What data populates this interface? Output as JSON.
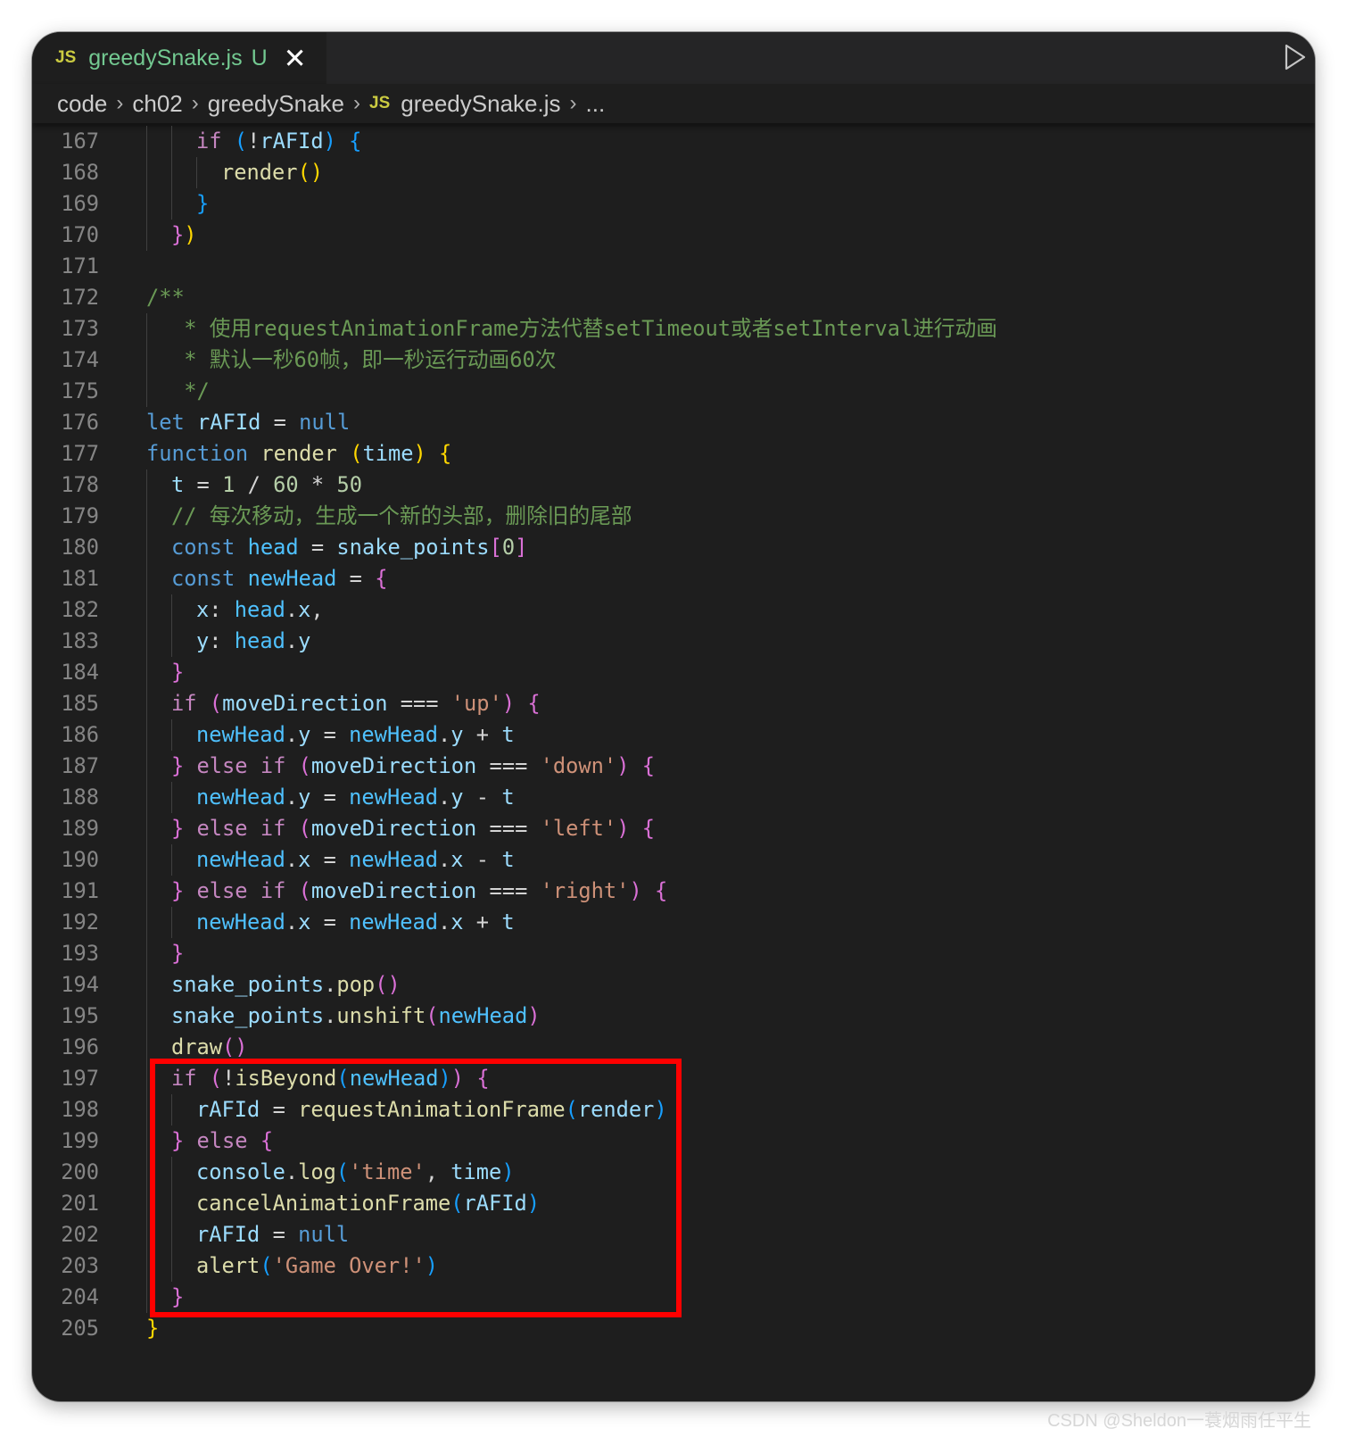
{
  "tab": {
    "file_icon": "JS",
    "title": "greedySnake.js",
    "status": "U",
    "close": "✕"
  },
  "breadcrumb": {
    "items": [
      "code",
      "ch02",
      "greedySnake"
    ],
    "file_icon": "JS",
    "file": "greedySnake.js",
    "more": "..."
  },
  "run_icon": "run-play-icon",
  "watermark": "CSDN @Sheldon一蓑烟雨任平生",
  "highlight_color": "#ff0000",
  "lines": [
    {
      "n": "167",
      "g": [
        1,
        2
      ],
      "t": [
        [
          "ctl",
          "if "
        ],
        [
          "b3",
          "("
        ],
        [
          "op",
          "!"
        ],
        [
          "var",
          "rAFId"
        ],
        [
          "b3",
          ")"
        ],
        [
          "op",
          " "
        ],
        [
          "b3",
          "{"
        ]
      ]
    },
    {
      "n": "168",
      "g": [
        1,
        2,
        3
      ],
      "t": [
        [
          "fn",
          "render"
        ],
        [
          "b1",
          "()"
        ]
      ]
    },
    {
      "n": "169",
      "g": [
        1,
        2
      ],
      "t": [
        [
          "b3",
          "}"
        ]
      ]
    },
    {
      "n": "170",
      "g": [
        1
      ],
      "t": [
        [
          "b2",
          "}"
        ],
        [
          "b1",
          ")"
        ]
      ]
    },
    {
      "n": "171",
      "g": [],
      "t": []
    },
    {
      "n": "172",
      "g": [],
      "t": [
        [
          "cmt",
          "/**"
        ]
      ]
    },
    {
      "n": "173",
      "g": [
        1
      ],
      "t": [
        [
          "cmt",
          " * 使用requestAnimationFrame方法代替setTimeout或者setInterval进行动画"
        ]
      ]
    },
    {
      "n": "174",
      "g": [
        1
      ],
      "t": [
        [
          "cmt",
          " * 默认一秒60帧，即一秒运行动画60次"
        ]
      ]
    },
    {
      "n": "175",
      "g": [
        1
      ],
      "t": [
        [
          "cmt",
          " */"
        ]
      ]
    },
    {
      "n": "176",
      "g": [],
      "t": [
        [
          "kw",
          "let "
        ],
        [
          "var",
          "rAFId"
        ],
        [
          "op",
          " = "
        ],
        [
          "kw",
          "null"
        ]
      ]
    },
    {
      "n": "177",
      "g": [],
      "t": [
        [
          "kw",
          "function "
        ],
        [
          "fn",
          "render"
        ],
        [
          "op",
          " "
        ],
        [
          "b1",
          "("
        ],
        [
          "var",
          "time"
        ],
        [
          "b1",
          ")"
        ],
        [
          "op",
          " "
        ],
        [
          "b1",
          "{"
        ]
      ]
    },
    {
      "n": "178",
      "g": [
        1
      ],
      "t": [
        [
          "var",
          "t"
        ],
        [
          "op",
          " = "
        ],
        [
          "num",
          "1"
        ],
        [
          "op",
          " / "
        ],
        [
          "num",
          "60"
        ],
        [
          "op",
          " * "
        ],
        [
          "num",
          "50"
        ]
      ]
    },
    {
      "n": "179",
      "g": [
        1
      ],
      "t": [
        [
          "cmt",
          "// 每次移动，生成一个新的头部，删除旧的尾部"
        ]
      ]
    },
    {
      "n": "180",
      "g": [
        1
      ],
      "t": [
        [
          "kw",
          "const "
        ],
        [
          "cst",
          "head"
        ],
        [
          "op",
          " = "
        ],
        [
          "var",
          "snake_points"
        ],
        [
          "b2",
          "["
        ],
        [
          "num",
          "0"
        ],
        [
          "b2",
          "]"
        ]
      ]
    },
    {
      "n": "181",
      "g": [
        1
      ],
      "t": [
        [
          "kw",
          "const "
        ],
        [
          "cst",
          "newHead"
        ],
        [
          "op",
          " = "
        ],
        [
          "b2",
          "{"
        ]
      ]
    },
    {
      "n": "182",
      "g": [
        1,
        2
      ],
      "t": [
        [
          "var",
          "x"
        ],
        [
          "op",
          ": "
        ],
        [
          "cst",
          "head"
        ],
        [
          "op",
          "."
        ],
        [
          "var",
          "x"
        ],
        [
          "op",
          ","
        ]
      ]
    },
    {
      "n": "183",
      "g": [
        1,
        2
      ],
      "t": [
        [
          "var",
          "y"
        ],
        [
          "op",
          ": "
        ],
        [
          "cst",
          "head"
        ],
        [
          "op",
          "."
        ],
        [
          "var",
          "y"
        ]
      ]
    },
    {
      "n": "184",
      "g": [
        1
      ],
      "t": [
        [
          "b2",
          "}"
        ]
      ]
    },
    {
      "n": "185",
      "g": [
        1
      ],
      "t": [
        [
          "ctl",
          "if "
        ],
        [
          "b2",
          "("
        ],
        [
          "var",
          "moveDirection"
        ],
        [
          "op",
          " === "
        ],
        [
          "str",
          "'up'"
        ],
        [
          "b2",
          ")"
        ],
        [
          "op",
          " "
        ],
        [
          "b2",
          "{"
        ]
      ]
    },
    {
      "n": "186",
      "g": [
        1,
        2
      ],
      "t": [
        [
          "cst",
          "newHead"
        ],
        [
          "op",
          "."
        ],
        [
          "var",
          "y"
        ],
        [
          "op",
          " = "
        ],
        [
          "cst",
          "newHead"
        ],
        [
          "op",
          "."
        ],
        [
          "var",
          "y"
        ],
        [
          "op",
          " + "
        ],
        [
          "var",
          "t"
        ]
      ]
    },
    {
      "n": "187",
      "g": [
        1
      ],
      "t": [
        [
          "b2",
          "}"
        ],
        [
          "ctl",
          " else if "
        ],
        [
          "b2",
          "("
        ],
        [
          "var",
          "moveDirection"
        ],
        [
          "op",
          " === "
        ],
        [
          "str",
          "'down'"
        ],
        [
          "b2",
          ")"
        ],
        [
          "op",
          " "
        ],
        [
          "b2",
          "{"
        ]
      ]
    },
    {
      "n": "188",
      "g": [
        1,
        2
      ],
      "t": [
        [
          "cst",
          "newHead"
        ],
        [
          "op",
          "."
        ],
        [
          "var",
          "y"
        ],
        [
          "op",
          " = "
        ],
        [
          "cst",
          "newHead"
        ],
        [
          "op",
          "."
        ],
        [
          "var",
          "y"
        ],
        [
          "op",
          " - "
        ],
        [
          "var",
          "t"
        ]
      ]
    },
    {
      "n": "189",
      "g": [
        1
      ],
      "t": [
        [
          "b2",
          "}"
        ],
        [
          "ctl",
          " else if "
        ],
        [
          "b2",
          "("
        ],
        [
          "var",
          "moveDirection"
        ],
        [
          "op",
          " === "
        ],
        [
          "str",
          "'left'"
        ],
        [
          "b2",
          ")"
        ],
        [
          "op",
          " "
        ],
        [
          "b2",
          "{"
        ]
      ]
    },
    {
      "n": "190",
      "g": [
        1,
        2
      ],
      "t": [
        [
          "cst",
          "newHead"
        ],
        [
          "op",
          "."
        ],
        [
          "var",
          "x"
        ],
        [
          "op",
          " = "
        ],
        [
          "cst",
          "newHead"
        ],
        [
          "op",
          "."
        ],
        [
          "var",
          "x"
        ],
        [
          "op",
          " - "
        ],
        [
          "var",
          "t"
        ]
      ]
    },
    {
      "n": "191",
      "g": [
        1
      ],
      "t": [
        [
          "b2",
          "}"
        ],
        [
          "ctl",
          " else if "
        ],
        [
          "b2",
          "("
        ],
        [
          "var",
          "moveDirection"
        ],
        [
          "op",
          " === "
        ],
        [
          "str",
          "'right'"
        ],
        [
          "b2",
          ")"
        ],
        [
          "op",
          " "
        ],
        [
          "b2",
          "{"
        ]
      ]
    },
    {
      "n": "192",
      "g": [
        1,
        2
      ],
      "t": [
        [
          "cst",
          "newHead"
        ],
        [
          "op",
          "."
        ],
        [
          "var",
          "x"
        ],
        [
          "op",
          " = "
        ],
        [
          "cst",
          "newHead"
        ],
        [
          "op",
          "."
        ],
        [
          "var",
          "x"
        ],
        [
          "op",
          " + "
        ],
        [
          "var",
          "t"
        ]
      ]
    },
    {
      "n": "193",
      "g": [
        1
      ],
      "t": [
        [
          "b2",
          "}"
        ]
      ]
    },
    {
      "n": "194",
      "g": [
        1
      ],
      "t": [
        [
          "var",
          "snake_points"
        ],
        [
          "op",
          "."
        ],
        [
          "fn",
          "pop"
        ],
        [
          "b2",
          "()"
        ]
      ]
    },
    {
      "n": "195",
      "g": [
        1
      ],
      "t": [
        [
          "var",
          "snake_points"
        ],
        [
          "op",
          "."
        ],
        [
          "fn",
          "unshift"
        ],
        [
          "b2",
          "("
        ],
        [
          "cst",
          "newHead"
        ],
        [
          "b2",
          ")"
        ]
      ]
    },
    {
      "n": "196",
      "g": [
        1
      ],
      "t": [
        [
          "fn",
          "draw"
        ],
        [
          "b2",
          "()"
        ]
      ]
    },
    {
      "n": "197",
      "g": [
        1
      ],
      "t": [
        [
          "ctl",
          "if "
        ],
        [
          "b2",
          "("
        ],
        [
          "op",
          "!"
        ],
        [
          "fn",
          "isBeyond"
        ],
        [
          "b3",
          "("
        ],
        [
          "cst",
          "newHead"
        ],
        [
          "b3",
          ")"
        ],
        [
          "b2",
          ")"
        ],
        [
          "op",
          " "
        ],
        [
          "b2",
          "{"
        ]
      ]
    },
    {
      "n": "198",
      "g": [
        1,
        2
      ],
      "t": [
        [
          "var",
          "rAFId"
        ],
        [
          "op",
          " = "
        ],
        [
          "fn",
          "requestAnimationFrame"
        ],
        [
          "b3",
          "("
        ],
        [
          "var",
          "render"
        ],
        [
          "b3",
          ")"
        ]
      ]
    },
    {
      "n": "199",
      "g": [
        1
      ],
      "t": [
        [
          "b2",
          "}"
        ],
        [
          "ctl",
          " else "
        ],
        [
          "b2",
          "{"
        ]
      ]
    },
    {
      "n": "200",
      "g": [
        1,
        2
      ],
      "t": [
        [
          "var",
          "console"
        ],
        [
          "op",
          "."
        ],
        [
          "fn",
          "log"
        ],
        [
          "b3",
          "("
        ],
        [
          "str",
          "'time'"
        ],
        [
          "op",
          ", "
        ],
        [
          "var",
          "time"
        ],
        [
          "b3",
          ")"
        ]
      ]
    },
    {
      "n": "201",
      "g": [
        1,
        2
      ],
      "t": [
        [
          "fn",
          "cancelAnimationFrame"
        ],
        [
          "b3",
          "("
        ],
        [
          "var",
          "rAFId"
        ],
        [
          "b3",
          ")"
        ]
      ]
    },
    {
      "n": "202",
      "g": [
        1,
        2
      ],
      "t": [
        [
          "var",
          "rAFId"
        ],
        [
          "op",
          " = "
        ],
        [
          "kw",
          "null"
        ]
      ]
    },
    {
      "n": "203",
      "g": [
        1,
        2
      ],
      "t": [
        [
          "fn",
          "alert"
        ],
        [
          "b3",
          "("
        ],
        [
          "str",
          "'Game Over!'"
        ],
        [
          "b3",
          ")"
        ]
      ]
    },
    {
      "n": "204",
      "g": [
        1
      ],
      "t": [
        [
          "b2",
          "}"
        ]
      ]
    },
    {
      "n": "205",
      "g": [],
      "t": [
        [
          "b1",
          "}"
        ]
      ]
    }
  ]
}
